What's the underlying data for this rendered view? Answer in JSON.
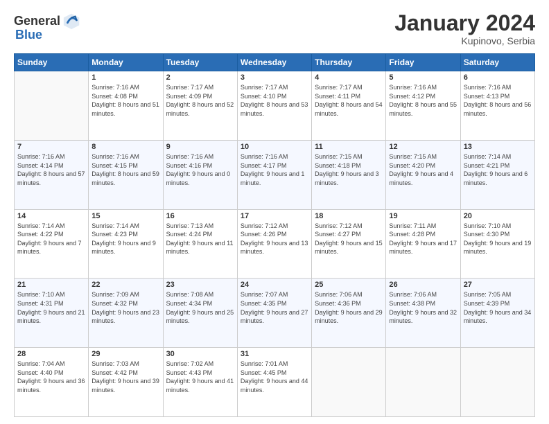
{
  "header": {
    "logo_general": "General",
    "logo_blue": "Blue",
    "month_title": "January 2024",
    "location": "Kupinovo, Serbia"
  },
  "days_of_week": [
    "Sunday",
    "Monday",
    "Tuesday",
    "Wednesday",
    "Thursday",
    "Friday",
    "Saturday"
  ],
  "weeks": [
    [
      {
        "day": "",
        "sunrise": "",
        "sunset": "",
        "daylight": ""
      },
      {
        "day": "1",
        "sunrise": "Sunrise: 7:16 AM",
        "sunset": "Sunset: 4:08 PM",
        "daylight": "Daylight: 8 hours and 51 minutes."
      },
      {
        "day": "2",
        "sunrise": "Sunrise: 7:17 AM",
        "sunset": "Sunset: 4:09 PM",
        "daylight": "Daylight: 8 hours and 52 minutes."
      },
      {
        "day": "3",
        "sunrise": "Sunrise: 7:17 AM",
        "sunset": "Sunset: 4:10 PM",
        "daylight": "Daylight: 8 hours and 53 minutes."
      },
      {
        "day": "4",
        "sunrise": "Sunrise: 7:17 AM",
        "sunset": "Sunset: 4:11 PM",
        "daylight": "Daylight: 8 hours and 54 minutes."
      },
      {
        "day": "5",
        "sunrise": "Sunrise: 7:16 AM",
        "sunset": "Sunset: 4:12 PM",
        "daylight": "Daylight: 8 hours and 55 minutes."
      },
      {
        "day": "6",
        "sunrise": "Sunrise: 7:16 AM",
        "sunset": "Sunset: 4:13 PM",
        "daylight": "Daylight: 8 hours and 56 minutes."
      }
    ],
    [
      {
        "day": "7",
        "sunrise": "Sunrise: 7:16 AM",
        "sunset": "Sunset: 4:14 PM",
        "daylight": "Daylight: 8 hours and 57 minutes."
      },
      {
        "day": "8",
        "sunrise": "Sunrise: 7:16 AM",
        "sunset": "Sunset: 4:15 PM",
        "daylight": "Daylight: 8 hours and 59 minutes."
      },
      {
        "day": "9",
        "sunrise": "Sunrise: 7:16 AM",
        "sunset": "Sunset: 4:16 PM",
        "daylight": "Daylight: 9 hours and 0 minutes."
      },
      {
        "day": "10",
        "sunrise": "Sunrise: 7:16 AM",
        "sunset": "Sunset: 4:17 PM",
        "daylight": "Daylight: 9 hours and 1 minute."
      },
      {
        "day": "11",
        "sunrise": "Sunrise: 7:15 AM",
        "sunset": "Sunset: 4:18 PM",
        "daylight": "Daylight: 9 hours and 3 minutes."
      },
      {
        "day": "12",
        "sunrise": "Sunrise: 7:15 AM",
        "sunset": "Sunset: 4:20 PM",
        "daylight": "Daylight: 9 hours and 4 minutes."
      },
      {
        "day": "13",
        "sunrise": "Sunrise: 7:14 AM",
        "sunset": "Sunset: 4:21 PM",
        "daylight": "Daylight: 9 hours and 6 minutes."
      }
    ],
    [
      {
        "day": "14",
        "sunrise": "Sunrise: 7:14 AM",
        "sunset": "Sunset: 4:22 PM",
        "daylight": "Daylight: 9 hours and 7 minutes."
      },
      {
        "day": "15",
        "sunrise": "Sunrise: 7:14 AM",
        "sunset": "Sunset: 4:23 PM",
        "daylight": "Daylight: 9 hours and 9 minutes."
      },
      {
        "day": "16",
        "sunrise": "Sunrise: 7:13 AM",
        "sunset": "Sunset: 4:24 PM",
        "daylight": "Daylight: 9 hours and 11 minutes."
      },
      {
        "day": "17",
        "sunrise": "Sunrise: 7:12 AM",
        "sunset": "Sunset: 4:26 PM",
        "daylight": "Daylight: 9 hours and 13 minutes."
      },
      {
        "day": "18",
        "sunrise": "Sunrise: 7:12 AM",
        "sunset": "Sunset: 4:27 PM",
        "daylight": "Daylight: 9 hours and 15 minutes."
      },
      {
        "day": "19",
        "sunrise": "Sunrise: 7:11 AM",
        "sunset": "Sunset: 4:28 PM",
        "daylight": "Daylight: 9 hours and 17 minutes."
      },
      {
        "day": "20",
        "sunrise": "Sunrise: 7:10 AM",
        "sunset": "Sunset: 4:30 PM",
        "daylight": "Daylight: 9 hours and 19 minutes."
      }
    ],
    [
      {
        "day": "21",
        "sunrise": "Sunrise: 7:10 AM",
        "sunset": "Sunset: 4:31 PM",
        "daylight": "Daylight: 9 hours and 21 minutes."
      },
      {
        "day": "22",
        "sunrise": "Sunrise: 7:09 AM",
        "sunset": "Sunset: 4:32 PM",
        "daylight": "Daylight: 9 hours and 23 minutes."
      },
      {
        "day": "23",
        "sunrise": "Sunrise: 7:08 AM",
        "sunset": "Sunset: 4:34 PM",
        "daylight": "Daylight: 9 hours and 25 minutes."
      },
      {
        "day": "24",
        "sunrise": "Sunrise: 7:07 AM",
        "sunset": "Sunset: 4:35 PM",
        "daylight": "Daylight: 9 hours and 27 minutes."
      },
      {
        "day": "25",
        "sunrise": "Sunrise: 7:06 AM",
        "sunset": "Sunset: 4:36 PM",
        "daylight": "Daylight: 9 hours and 29 minutes."
      },
      {
        "day": "26",
        "sunrise": "Sunrise: 7:06 AM",
        "sunset": "Sunset: 4:38 PM",
        "daylight": "Daylight: 9 hours and 32 minutes."
      },
      {
        "day": "27",
        "sunrise": "Sunrise: 7:05 AM",
        "sunset": "Sunset: 4:39 PM",
        "daylight": "Daylight: 9 hours and 34 minutes."
      }
    ],
    [
      {
        "day": "28",
        "sunrise": "Sunrise: 7:04 AM",
        "sunset": "Sunset: 4:40 PM",
        "daylight": "Daylight: 9 hours and 36 minutes."
      },
      {
        "day": "29",
        "sunrise": "Sunrise: 7:03 AM",
        "sunset": "Sunset: 4:42 PM",
        "daylight": "Daylight: 9 hours and 39 minutes."
      },
      {
        "day": "30",
        "sunrise": "Sunrise: 7:02 AM",
        "sunset": "Sunset: 4:43 PM",
        "daylight": "Daylight: 9 hours and 41 minutes."
      },
      {
        "day": "31",
        "sunrise": "Sunrise: 7:01 AM",
        "sunset": "Sunset: 4:45 PM",
        "daylight": "Daylight: 9 hours and 44 minutes."
      },
      {
        "day": "",
        "sunrise": "",
        "sunset": "",
        "daylight": ""
      },
      {
        "day": "",
        "sunrise": "",
        "sunset": "",
        "daylight": ""
      },
      {
        "day": "",
        "sunrise": "",
        "sunset": "",
        "daylight": ""
      }
    ]
  ]
}
